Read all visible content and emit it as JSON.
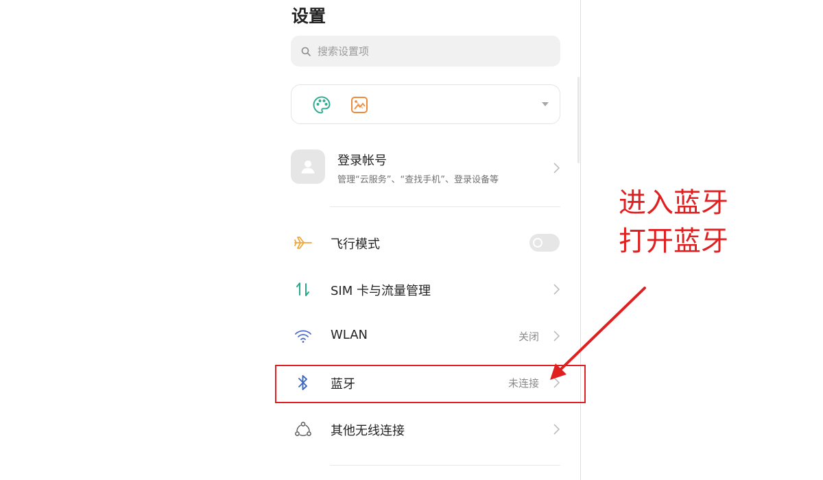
{
  "header": {
    "title": "设置"
  },
  "search": {
    "placeholder": "搜索设置项",
    "value": ""
  },
  "account": {
    "title": "登录帐号",
    "subtitle": "管理“云服务”、“查找手机”、登录设备等"
  },
  "settings": [
    {
      "label": "飞行模式",
      "icon": "airplane-icon",
      "control": "toggle",
      "toggle_on": false
    },
    {
      "label": "SIM 卡与流量管理",
      "icon": "sim-data-icon",
      "control": "chevron"
    },
    {
      "label": "WLAN",
      "value": "关闭",
      "icon": "wifi-icon",
      "control": "chevron"
    },
    {
      "label": "蓝牙",
      "value": "未连接",
      "icon": "bluetooth-icon",
      "control": "chevron"
    },
    {
      "label": "其他无线连接",
      "icon": "other-wireless-icon",
      "control": "chevron"
    }
  ],
  "annotation": {
    "line1": "进入蓝牙",
    "line2": "打开蓝牙"
  },
  "colors": {
    "annotation": "#e02020",
    "airplane": "#f0a63a",
    "sim": "#27a88a",
    "wifi": "#4a6cc8",
    "bluetooth": "#3a67c4",
    "palette": "#2fae94",
    "wallpaper": "#ee8a3a"
  }
}
